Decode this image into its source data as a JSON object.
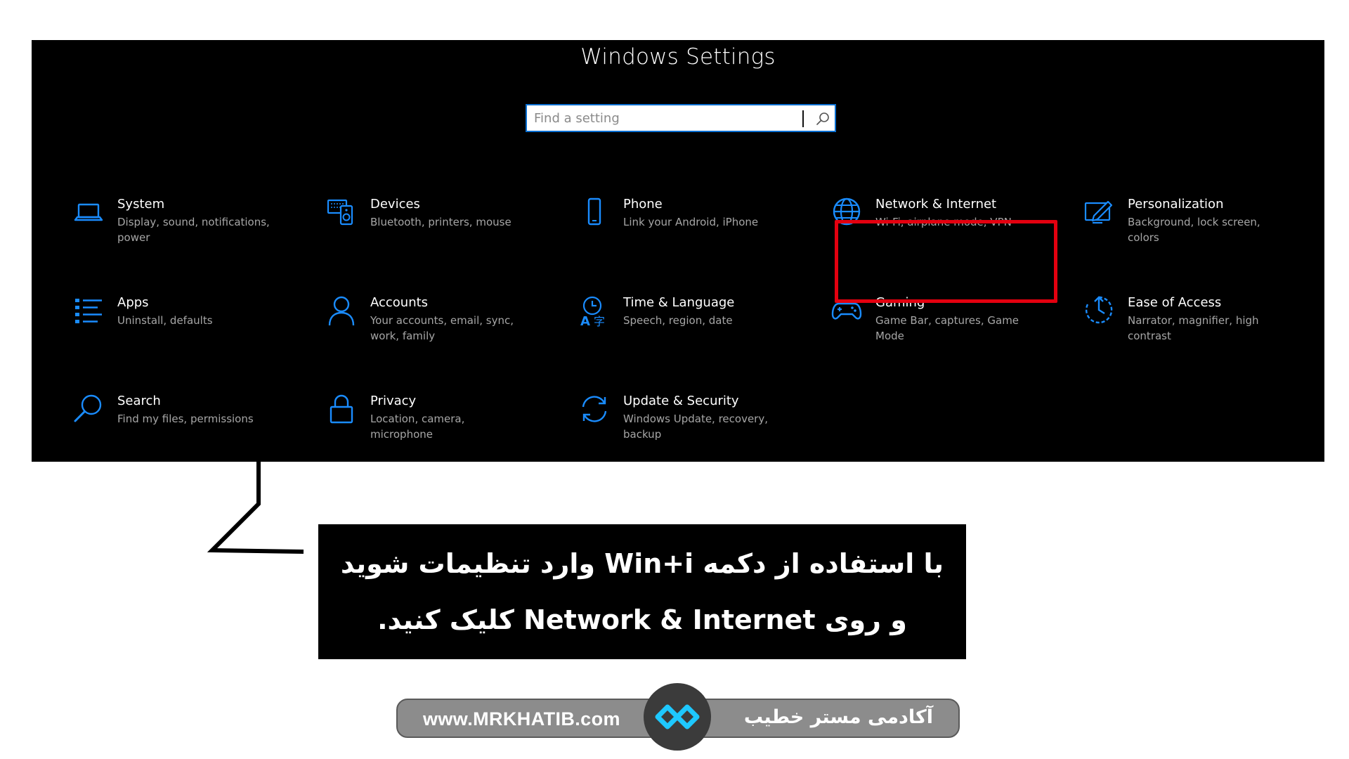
{
  "window": {
    "title": "Windows Settings"
  },
  "search": {
    "placeholder": "Find a setting"
  },
  "tiles": [
    {
      "title": "System",
      "description": "Display, sound, notifications, power",
      "icon": "laptop-icon"
    },
    {
      "title": "Devices",
      "description": "Bluetooth, printers, mouse",
      "icon": "devices-icon"
    },
    {
      "title": "Phone",
      "description": "Link your Android, iPhone",
      "icon": "phone-icon"
    },
    {
      "title": "Network & Internet",
      "description": "Wi-Fi, airplane mode, VPN",
      "icon": "globe-icon"
    },
    {
      "title": "Personalization",
      "description": "Background, lock screen, colors",
      "icon": "pen-monitor-icon"
    },
    {
      "title": "Apps",
      "description": "Uninstall, defaults",
      "icon": "apps-list-icon"
    },
    {
      "title": "Accounts",
      "description": "Your accounts, email, sync, work, family",
      "icon": "person-icon"
    },
    {
      "title": "Time & Language",
      "description": "Speech, region, date",
      "icon": "time-language-icon"
    },
    {
      "title": "Gaming",
      "description": "Game Bar, captures, Game Mode",
      "icon": "gamepad-icon"
    },
    {
      "title": "Ease of Access",
      "description": "Narrator, magnifier, high contrast",
      "icon": "ease-of-access-icon"
    },
    {
      "title": "Search",
      "description": "Find my files, permissions",
      "icon": "search-magnifier-icon"
    },
    {
      "title": "Privacy",
      "description": "Location, camera, microphone",
      "icon": "lock-icon"
    },
    {
      "title": "Update & Security",
      "description": "Windows Update, recovery, backup",
      "icon": "sync-arrows-icon"
    }
  ],
  "instruction": {
    "line1": "با استفاده از دکمه Win+i وارد تنظیمات شوید",
    "line2": "و روی Network & Internet کلیک کنید."
  },
  "brand": {
    "url": "www.MRKHATIB.com",
    "name": "آکادمی مستر خطیب"
  },
  "colors": {
    "accent_blue": "#1a8cff",
    "highlight_red": "#e3000f",
    "window_bg": "#000000",
    "description_gray": "#a6a6a6",
    "brand_pill": "#8c8c8c",
    "logo_cyan": "#1ec8ff"
  }
}
